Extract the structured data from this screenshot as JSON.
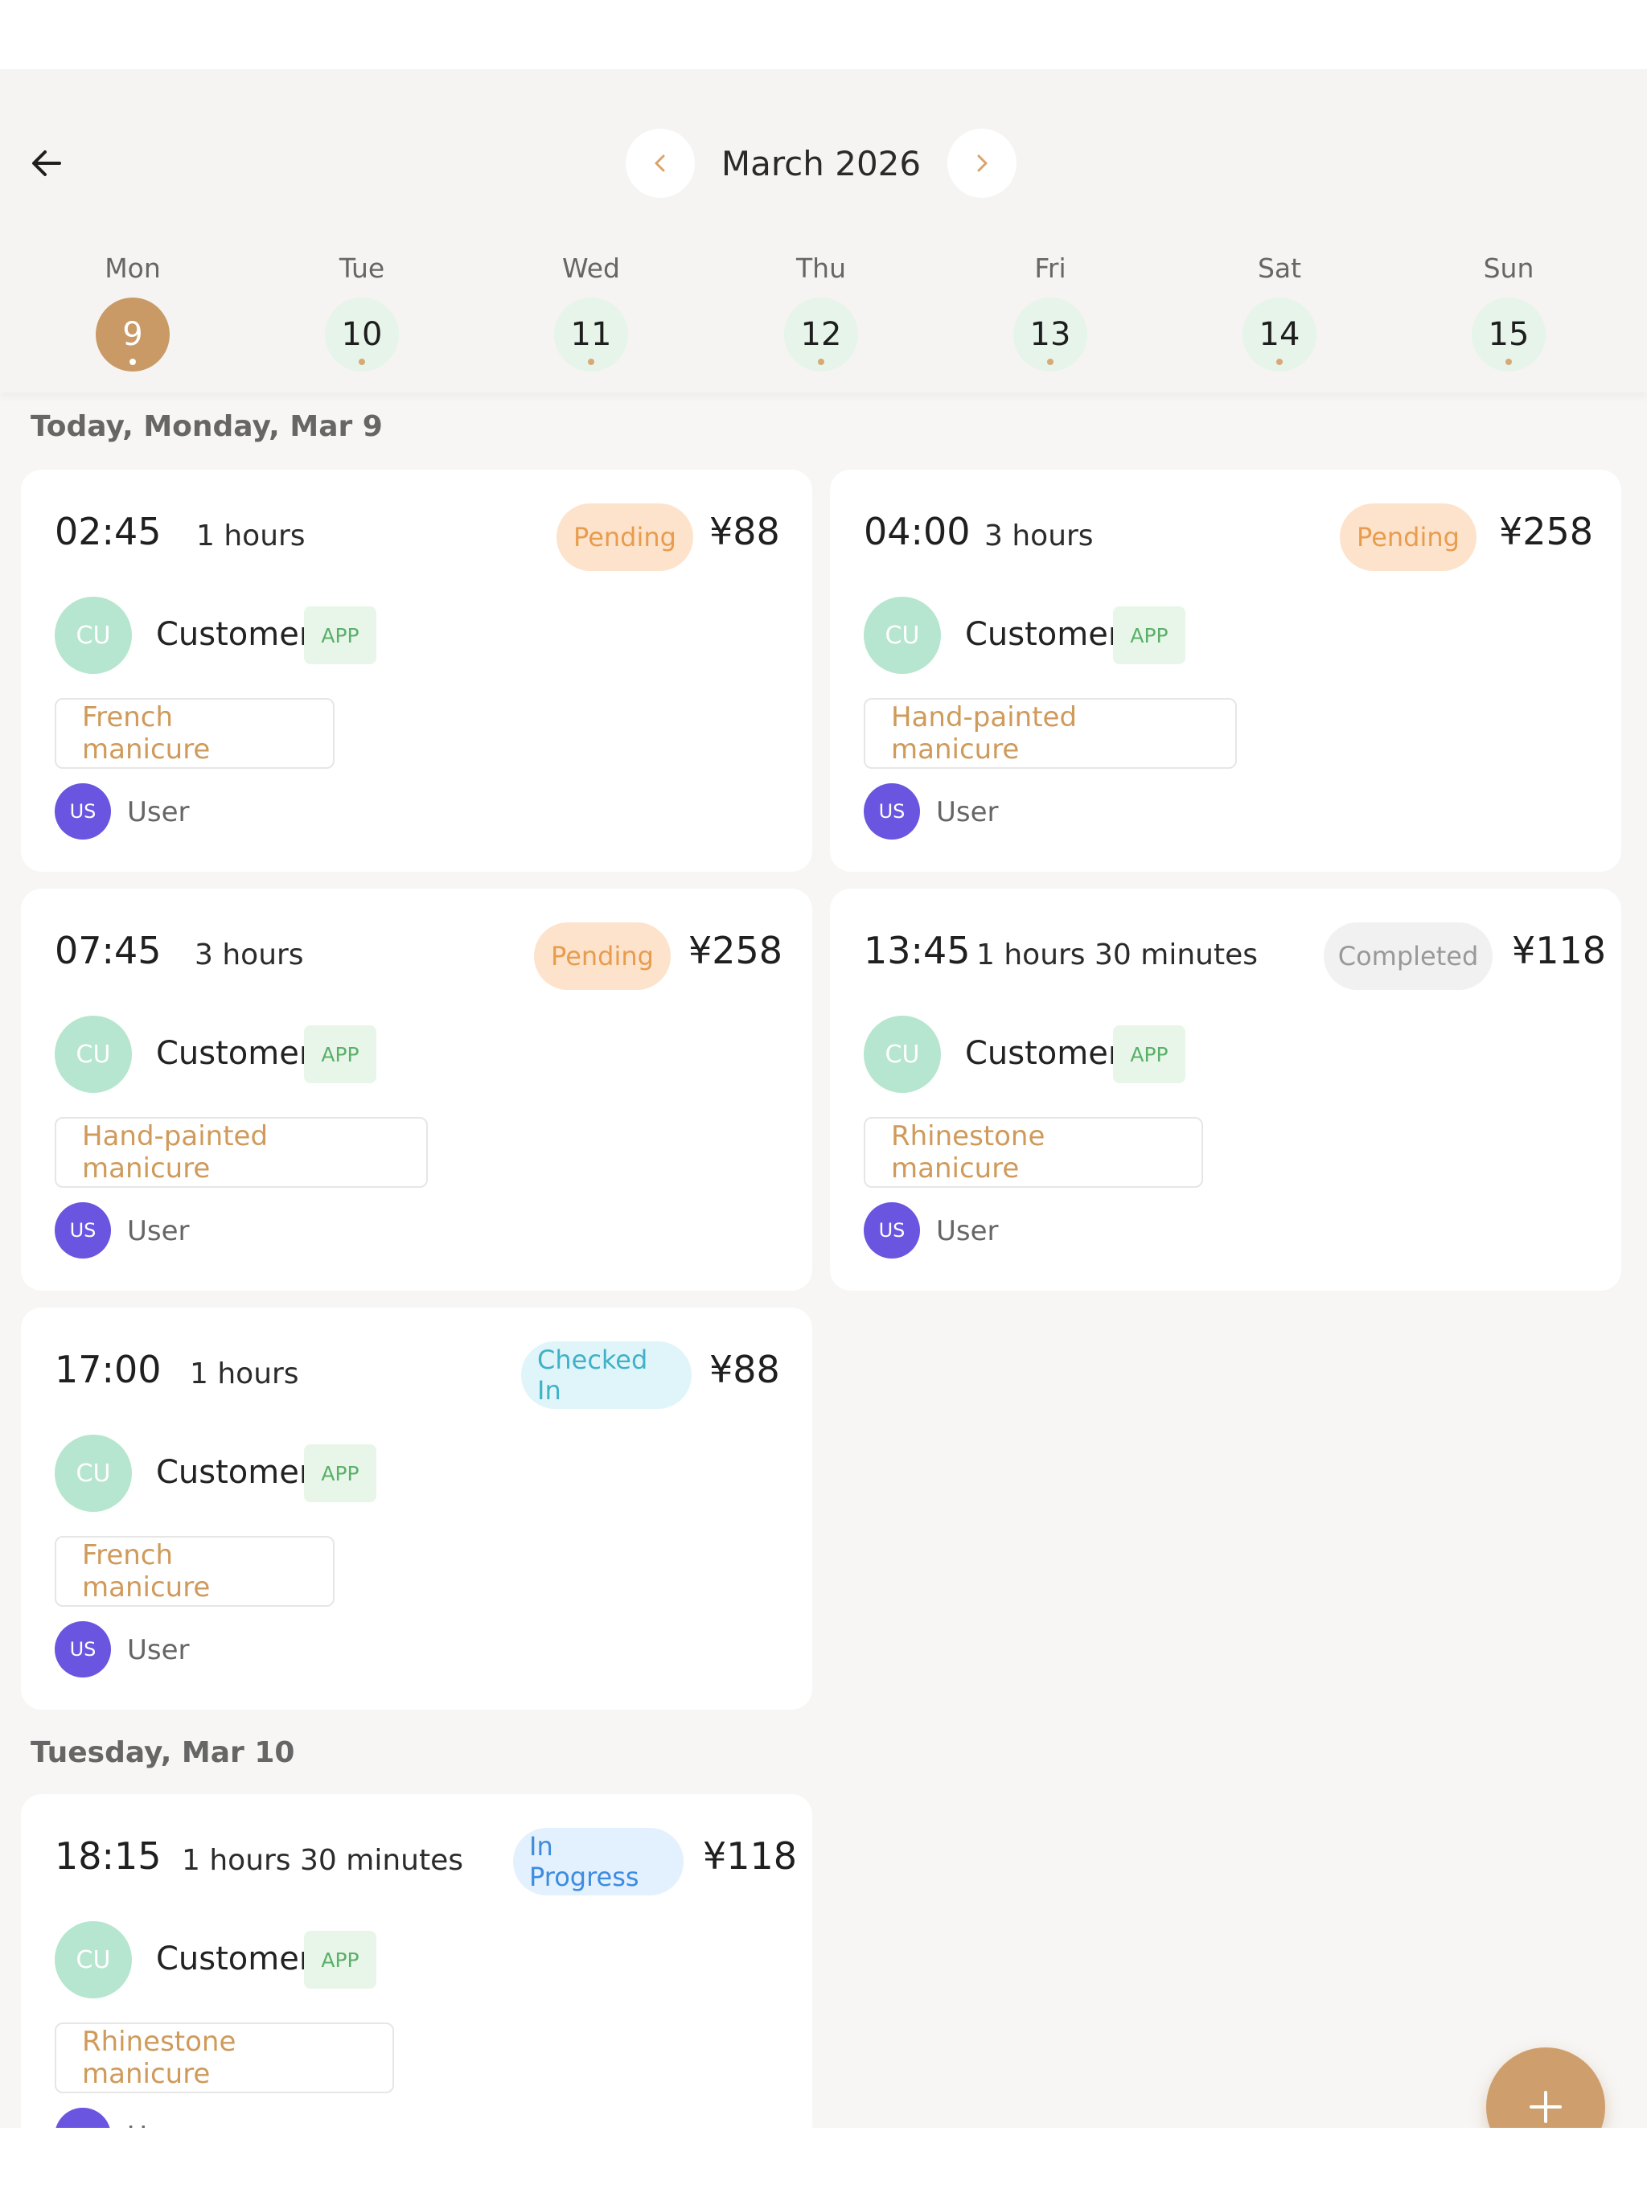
{
  "header": {
    "month_label": "March 2026",
    "days": [
      {
        "name": "Mon",
        "date": "9",
        "selected": true
      },
      {
        "name": "Tue",
        "date": "10"
      },
      {
        "name": "Wed",
        "date": "11"
      },
      {
        "name": "Thu",
        "date": "12"
      },
      {
        "name": "Fri",
        "date": "13"
      },
      {
        "name": "Sat",
        "date": "14"
      },
      {
        "name": "Sun",
        "date": "15"
      }
    ]
  },
  "sections": [
    {
      "heading": "Today, Monday, Mar 9",
      "appointments": [
        {
          "time": "02:45",
          "duration": "1 hours",
          "status": "Pending",
          "price": "¥88",
          "customer_initials": "CU",
          "customer": "Customer",
          "source": "APP",
          "service": "French manicure",
          "user_initials": "US",
          "user": "User"
        },
        {
          "time": "04:00",
          "duration": "3 hours",
          "status": "Pending",
          "price": "¥258",
          "customer_initials": "CU",
          "customer": "Customer",
          "source": "APP",
          "service": "Hand-painted manicure",
          "user_initials": "US",
          "user": "User"
        },
        {
          "time": "07:45",
          "duration": "3 hours",
          "status": "Pending",
          "price": "¥258",
          "customer_initials": "CU",
          "customer": "Customer",
          "source": "APP",
          "service": "Hand-painted manicure",
          "user_initials": "US",
          "user": "User"
        },
        {
          "time": "13:45",
          "duration": "1 hours 30 minutes",
          "status": "Completed",
          "price": "¥118",
          "customer_initials": "CU",
          "customer": "Customer",
          "source": "APP",
          "service": "Rhinestone manicure",
          "user_initials": "US",
          "user": "User"
        },
        {
          "time": "17:00",
          "duration": "1 hours",
          "status": "Checked In",
          "price": "¥88",
          "customer_initials": "CU",
          "customer": "Customer",
          "source": "APP",
          "service": "French manicure",
          "user_initials": "US",
          "user": "User"
        }
      ]
    },
    {
      "heading": "Tuesday, Mar 10",
      "appointments": [
        {
          "time": "18:15",
          "duration": "1 hours 30 minutes",
          "status": "In Progress",
          "price": "¥118",
          "customer_initials": "CU",
          "customer": "Customer",
          "source": "APP",
          "service": "Rhinestone manicure",
          "user_initials": "US",
          "user": "User"
        }
      ]
    }
  ],
  "icons": {
    "back": "arrow-left-icon",
    "prev_month": "chevron-left-icon",
    "next_month": "chevron-right-icon",
    "add": "plus-icon"
  },
  "colors": {
    "accent": "#c99a66",
    "pending_bg": "#fde3cc",
    "pending_text": "#e89c4d",
    "completed_bg": "#f1f1f1",
    "completed_text": "#999999",
    "checked_in_bg": "#e0f5fa",
    "checked_in_text": "#3fb2c8",
    "in_progress_bg": "#e3f0fd",
    "in_progress_text": "#3c8ce0",
    "customer_avatar": "#b6e6cf",
    "user_avatar": "#6a55e0",
    "app_badge_bg": "#e8f6ea",
    "app_badge_text": "#5ab068",
    "service_text": "#cf9a5a"
  }
}
